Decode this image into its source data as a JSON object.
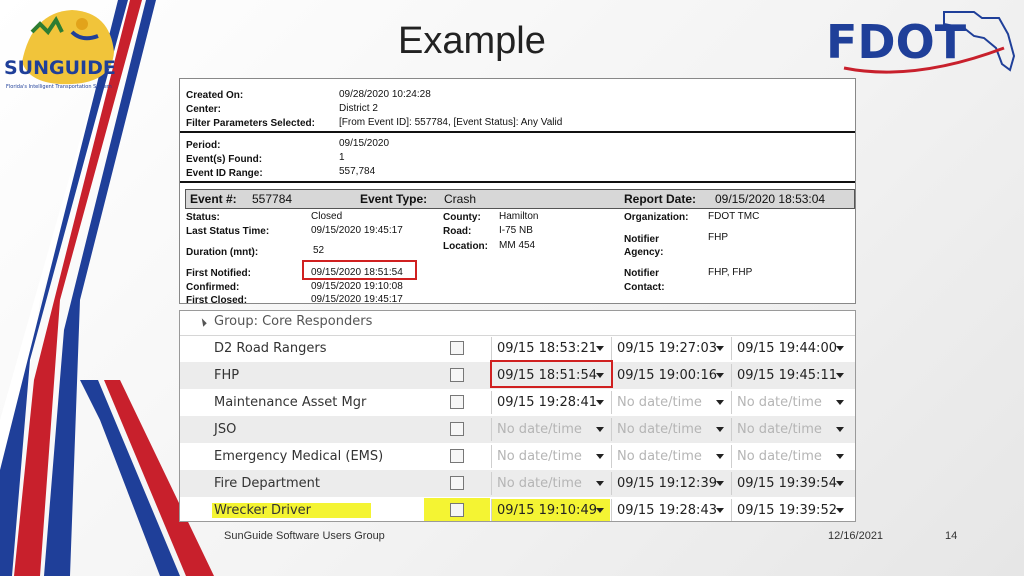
{
  "slide": {
    "title": "Example",
    "footer_left": "SunGuide Software Users Group",
    "footer_date": "12/16/2021",
    "page_number": "14"
  },
  "logos": {
    "sunguide": {
      "name": "SUNGUIDE",
      "tagline": "Florida's Intelligent Transportation System"
    },
    "fdot": {
      "name": "FDOT"
    }
  },
  "report": {
    "header_rows": [
      {
        "label": "Created On:",
        "value": "09/28/2020 10:24:28"
      },
      {
        "label": "Center:",
        "value": "District 2"
      },
      {
        "label": "Filter Parameters Selected:",
        "value": "[From Event ID]: 557784, [Event Status]: Any Valid"
      }
    ],
    "period_rows": [
      {
        "label": "Period:",
        "value": "09/15/2020"
      },
      {
        "label": "Event(s) Found:",
        "value": "1"
      },
      {
        "label": "Event ID Range:",
        "value": "557,784"
      }
    ],
    "event_bar": {
      "event_label": "Event #:",
      "event_value": "557784",
      "type_label": "Event Type:",
      "type_value": "Crash",
      "date_label": "Report Date:",
      "date_value": "09/15/2020  18:53:04"
    },
    "status": {
      "status_label": "Status:",
      "status_value": "Closed",
      "last_status_label": "Last Status Time:",
      "last_status_value": "09/15/2020  19:45:17",
      "duration_label": "Duration (mnt):",
      "duration_value": "52",
      "first_notified_label": "First Notified:",
      "first_notified_value": "09/15/2020  18:51:54",
      "confirmed_label": "Confirmed:",
      "confirmed_value": "09/15/2020  19:10:08",
      "first_closed_label": "First Closed:",
      "first_closed_value": "09/15/2020  19:45:17"
    },
    "location": {
      "county_label": "County:",
      "county_value": "Hamilton",
      "road_label": "Road:",
      "road_value": "I-75 NB",
      "location_label": "Location:",
      "location_value": "MM 454"
    },
    "org": {
      "org_label": "Organization:",
      "org_value": "FDOT TMC",
      "notifier_agency_label1": "Notifier",
      "notifier_agency_label2": "Agency:",
      "notifier_agency_value": "FHP",
      "notifier_contact_label1": "Notifier",
      "notifier_contact_label2": "Contact:",
      "notifier_contact_value": "FHP, FHP"
    }
  },
  "grid": {
    "group_header": "Group: Core Responders",
    "rows": [
      {
        "name": "D2 Road Rangers",
        "c1": "09/15 18:53:21",
        "c2": "09/15 19:27:03",
        "c3": "09/15 19:44:00"
      },
      {
        "name": "FHP",
        "c1": "09/15 18:51:54",
        "c2": "09/15 19:00:16",
        "c3": "09/15 19:45:11"
      },
      {
        "name": "Maintenance Asset Mgr",
        "c1": "09/15 19:28:41",
        "c2": "No date/time",
        "c3": "No date/time"
      },
      {
        "name": "JSO",
        "c1": "No date/time",
        "c2": "No date/time",
        "c3": "No date/time"
      },
      {
        "name": "Emergency Medical (EMS)",
        "c1": "No date/time",
        "c2": "No date/time",
        "c3": "No date/time"
      },
      {
        "name": "Fire Department",
        "c1": "No date/time",
        "c2": "09/15 19:12:39",
        "c3": "09/15 19:39:54"
      },
      {
        "name": "Wrecker Driver",
        "c1": "09/15 19:10:49",
        "c2": "09/15 19:28:43",
        "c3": "09/15 19:39:52"
      }
    ]
  },
  "colors": {
    "red": "#c8202c",
    "blue": "#1f3f99",
    "highlight": "#f4f433"
  }
}
